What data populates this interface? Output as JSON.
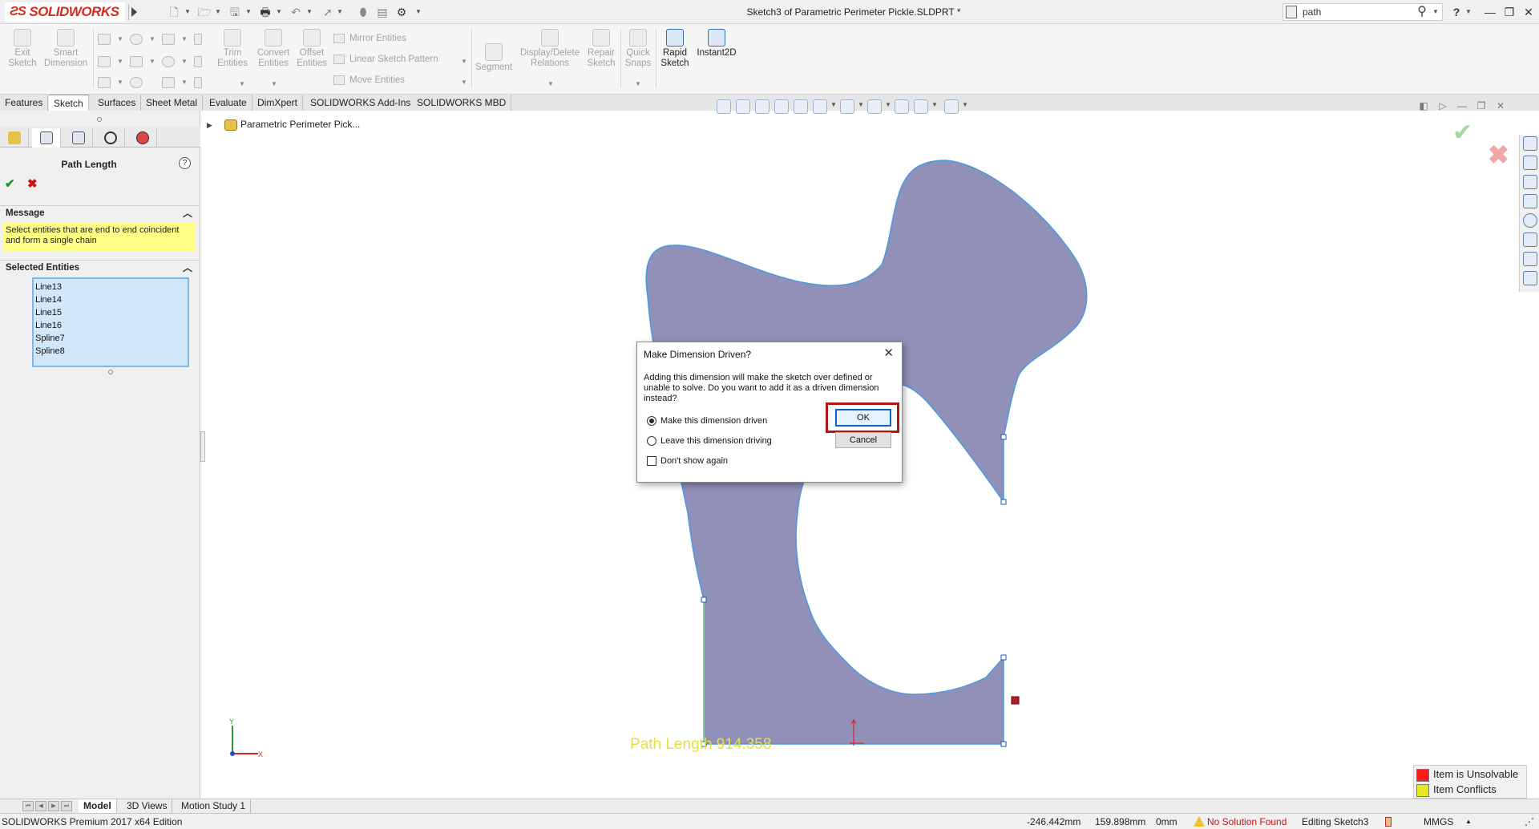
{
  "app": {
    "logo_text": "SOLIDWORKS",
    "title": "Sketch3 of Parametric Perimeter Pickle.SLDPRT *",
    "search_value": "path",
    "help_label": "?"
  },
  "command_manager": {
    "exit_sketch": "Exit\nSketch",
    "smart_dimension": "Smart\nDimension",
    "trim_entities": "Trim\nEntities",
    "convert_entities": "Convert\nEntities",
    "offset_entities": "Offset\nEntities",
    "mirror_entities": "Mirror Entities",
    "linear_sketch_pattern": "Linear Sketch Pattern",
    "move_entities": "Move Entities",
    "segment": "Segment",
    "display_delete_relations": "Display/Delete\nRelations",
    "repair_sketch": "Repair\nSketch",
    "quick_snaps": "Quick\nSnaps",
    "rapid_sketch": "Rapid\nSketch",
    "instant2d": "Instant2D"
  },
  "tabs": [
    "Features",
    "Sketch",
    "Surfaces",
    "Sheet Metal",
    "Evaluate",
    "DimXpert",
    "SOLIDWORKS Add-Ins",
    "SOLIDWORKS MBD"
  ],
  "active_tab": "Sketch",
  "property_manager": {
    "title": "Path Length",
    "help": "?",
    "message_header": "Message",
    "message_text": "Select entities that are end to end coincident and form a single chain",
    "selected_header": "Selected Entities",
    "entities": [
      "Line13",
      "Line14",
      "Line15",
      "Line16",
      "Spline7",
      "Spline8"
    ]
  },
  "feature_tree": {
    "item": "Parametric Perimeter Pick..."
  },
  "dialog": {
    "title": "Make Dimension Driven?",
    "message": "Adding this dimension will make the sketch over defined or unable to solve.  Do you want to add it as a driven dimension instead?",
    "option_driven": "Make this dimension driven",
    "option_driving": "Leave this dimension driving",
    "dont_show": "Don't show again",
    "ok": "OK",
    "cancel": "Cancel"
  },
  "graphics": {
    "path_label": "Path Length 914.358",
    "shape_fill": "#9090b8",
    "shape_stroke": "#4a9ae0"
  },
  "legend": {
    "unsolvable": "Item is Unsolvable",
    "conflicts": "Item Conflicts",
    "unsolvable_color": "#ff1a1a",
    "conflicts_color": "#e8e820"
  },
  "model_tabs": [
    "Model",
    "3D Views",
    "Motion Study 1"
  ],
  "active_model_tab": "Model",
  "status": {
    "edition": "SOLIDWORKS Premium 2017 x64 Edition",
    "x": "-246.442mm",
    "y": "159.898mm",
    "z": "0mm",
    "solution": "No Solution Found",
    "editing": "Editing Sketch3",
    "units": "MMGS"
  }
}
